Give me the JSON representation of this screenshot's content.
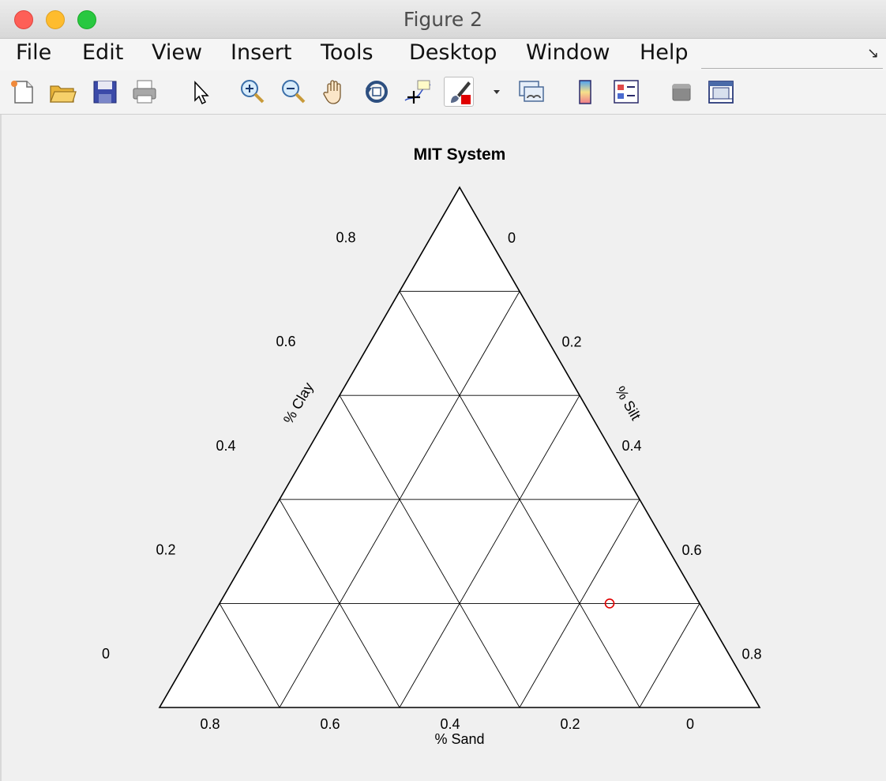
{
  "window": {
    "title": "Figure 2"
  },
  "menu": {
    "items": [
      "File",
      "Edit",
      "View",
      "Insert",
      "Tools",
      "Desktop",
      "Window",
      "Help"
    ]
  },
  "toolbar": {
    "icons": [
      "new-figure-icon",
      "open-file-icon",
      "save-icon",
      "print-icon",
      "pointer-icon",
      "zoom-in-icon",
      "zoom-out-icon",
      "pan-hand-icon",
      "rotate-3d-icon",
      "data-cursor-icon",
      "brush-icon",
      "link-plot-icon",
      "colorbar-icon",
      "legend-icon",
      "hide-plot-tools-icon",
      "show-plot-tools-icon"
    ]
  },
  "chart_data": {
    "type": "scatter",
    "subtype": "ternary",
    "title": "MIT System",
    "axes": {
      "clay": {
        "label": "% Clay",
        "ticks": [
          "0",
          "0.2",
          "0.4",
          "0.6",
          "0.8"
        ]
      },
      "silt": {
        "label": "% Silt",
        "ticks": [
          "0",
          "0.2",
          "0.4",
          "0.6",
          "0.8"
        ]
      },
      "sand": {
        "label": "% Sand",
        "ticks": [
          "0.8",
          "0.6",
          "0.4",
          "0.2",
          "0"
        ]
      }
    },
    "grid": true,
    "grid_step": 0.2,
    "points": [
      {
        "sand": 0.15,
        "silt": 0.65,
        "clay": 0.2,
        "marker": "circle",
        "color": "#e00000"
      }
    ]
  },
  "colors": {
    "marker": "#e00000",
    "figure_bg": "#f0f0f0",
    "axes_bg": "#ffffff"
  }
}
